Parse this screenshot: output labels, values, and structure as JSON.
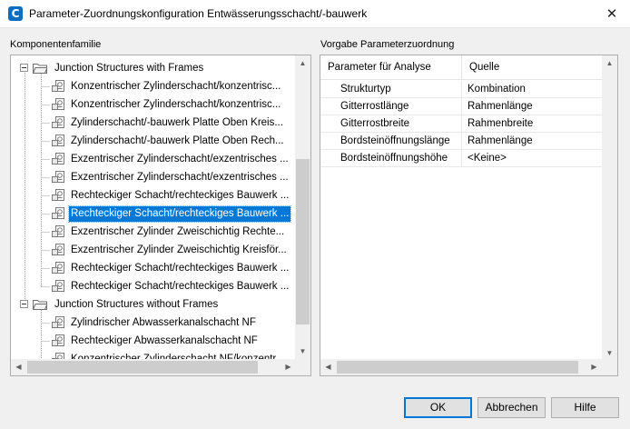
{
  "window": {
    "title": "Parameter-Zuordnungskonfiguration Entwässerungsschacht/-bauwerk",
    "app_icon_letter": "C",
    "close_glyph": "✕"
  },
  "left_panel": {
    "label": "Komponentenfamilie",
    "groups": [
      {
        "label": "Junction Structures with Frames",
        "items": [
          "Konzentrischer Zylinderschacht/konzentrisc...",
          "Konzentrischer Zylinderschacht/konzentrisc...",
          "Zylinderschacht/-bauwerk Platte Oben Kreis...",
          "Zylinderschacht/-bauwerk Platte Oben Rech...",
          "Exzentrischer Zylinderschacht/exzentrisches ...",
          "Exzentrischer Zylinderschacht/exzentrisches ...",
          "Rechteckiger Schacht/rechteckiges Bauwerk ...",
          "Rechteckiger Schacht/rechteckiges Bauwerk ...",
          "Exzentrischer Zylinder Zweischichtig Rechte...",
          "Exzentrischer Zylinder Zweischichtig Kreisför...",
          "Rechteckiger Schacht/rechteckiges Bauwerk ...",
          "Rechteckiger Schacht/rechteckiges Bauwerk ..."
        ],
        "selected_index": 7
      },
      {
        "label": "Junction Structures without Frames",
        "items": [
          "Zylindrischer Abwasserkanalschacht NF",
          "Rechteckiger Abwasserkanalschacht NF",
          "Konzentrischer Zylinderschacht NF/konzentr..."
        ],
        "selected_index": -1
      }
    ]
  },
  "right_panel": {
    "label": "Vorgabe Parameterzuordnung",
    "columns": [
      "Parameter für Analyse",
      "Quelle"
    ],
    "rows": [
      [
        "Strukturtyp",
        "Kombination"
      ],
      [
        "Gitterrostlänge",
        "Rahmenlänge"
      ],
      [
        "Gitterrostbreite",
        "Rahmenbreite"
      ],
      [
        "Bordsteinöffnungslänge",
        "Rahmenlänge"
      ],
      [
        "Bordsteinöffnungshöhe",
        "<Keine>"
      ]
    ]
  },
  "buttons": {
    "ok": "OK",
    "cancel": "Abbrechen",
    "help": "Hilfe"
  },
  "scroll_glyphs": {
    "up": "▲",
    "down": "▼",
    "left": "◀",
    "right": "▶"
  },
  "colors": {
    "selection": "#0078d7",
    "app_icon": "#0d6dbf"
  }
}
